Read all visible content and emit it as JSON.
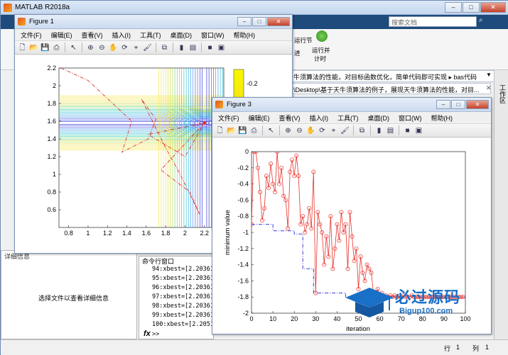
{
  "app": {
    "title": "MATLAB R2018a",
    "search_placeholder": "搜索文档",
    "ribbon_items": [
      "运行节",
      "进",
      "运行并",
      "计时"
    ],
    "path_top": "牛须算法的性能，对目标函数优化，简单代码即可实现 ▸ bas代码",
    "path_second": "\\Desktop\\基于天牛须算法的例子，展现天牛须算法的性能，对目...",
    "workspace_label": "工作区",
    "detail_header": "详细信息",
    "detail_message": "选择文件以查看详细信息",
    "cmd_header": "命令行窗口",
    "cmd_lines": [
      "94:xbest=[2.20361",
      "95:xbest=[2.20361",
      "96:xbest=[2.20361",
      "97:xbest=[2.20361",
      "98:xbest=[2.20361",
      "99:xbest=[2.20361",
      "100:xbest=[2.2051"
    ],
    "cmd_prompt": ">>",
    "status_row_label": "行",
    "status_row": "1",
    "status_col_label": "列",
    "status_col": "1"
  },
  "figure1": {
    "title": "Figure 1",
    "menu": [
      "文件(F)",
      "编辑(E)",
      "查看(V)",
      "插入(I)",
      "工具(T)",
      "桌面(D)",
      "窗口(W)",
      "帮助(H)"
    ]
  },
  "figure3": {
    "title": "Figure 3",
    "menu": [
      "文件(F)",
      "编辑(E)",
      "查看(V)",
      "插入(I)",
      "工具(T)",
      "桌面(D)",
      "窗口(W)",
      "帮助(H)"
    ]
  },
  "watermark": {
    "text_cn": "必过源码",
    "text_en": "Bigup100.com"
  },
  "colors": {
    "accent": "#1e4a7c",
    "series_red": "#e8322b",
    "series_blue": "#3a3ad8"
  },
  "chart_data": [
    {
      "type": "contour",
      "title": "",
      "xlabel": "",
      "ylabel": "",
      "xlim": [
        0.7,
        2.4
      ],
      "ylim": [
        0.4,
        2.2
      ],
      "xticks": [
        0.8,
        1,
        1.2,
        1.4,
        1.6,
        1.8,
        2,
        2.2
      ],
      "xtick_labels": [
        "0.8",
        "1",
        "1.2",
        "1.4",
        "1.6",
        "1.8",
        "2",
        "2.2"
      ],
      "yticks": [
        0.6,
        0.8,
        1,
        1.2,
        1.4,
        1.6,
        1.8,
        2,
        2.2
      ],
      "ytick_labels": [
        "0.6",
        "0.8",
        "1",
        "1.2",
        "1.4",
        "1.6",
        "1.8",
        "2",
        "2.2"
      ],
      "colorbar_tick": "-0.2",
      "optimum": [
        2.2,
        1.58
      ]
    },
    {
      "type": "line",
      "title": "",
      "xlabel": "iteration",
      "ylabel": "minimum value",
      "xlim": [
        0,
        100
      ],
      "ylim": [
        -2,
        0
      ],
      "xticks": [
        0,
        10,
        20,
        30,
        40,
        50,
        60,
        70,
        80,
        90,
        100
      ],
      "yticks": [
        0,
        -0.2,
        -0.4,
        -0.6,
        -0.8,
        -1,
        -1.2,
        -1.4,
        -1.6,
        -1.8,
        -2
      ],
      "ytick_labels": [
        "0",
        "-0.2",
        "-0.4",
        "-0.6",
        "-0.8",
        "-1",
        "-1.2",
        "-1.4",
        "-1.6",
        "-1.8",
        "-2"
      ],
      "series": [
        {
          "values": [
            -0.9,
            0,
            0,
            -0.2,
            -0.5,
            -0.85,
            -0.7,
            -0.3,
            -0.45,
            -0.15,
            -0.4,
            -0.5,
            0,
            -0.4,
            -0.2,
            -0.55,
            -0.6,
            -0.95,
            -0.25,
            -0.1,
            -0.3,
            -0.05,
            -0.3,
            -0.9,
            -0.8,
            -1.0,
            -0.9,
            -0.7,
            -0.95,
            -0.25,
            -1.75,
            -0.75,
            -0.9,
            -1.0,
            -1.4,
            -1.05,
            -1.3,
            -0.8,
            -1.45,
            -1.2,
            -0.9,
            -1.1,
            -0.75,
            -1.0,
            -0.9,
            -1.45,
            -0.75,
            -1.05,
            -1.35,
            -1.2,
            -1.7,
            -1.3,
            -1.5,
            -1.6,
            -1.4,
            -1.45,
            -1.5,
            -1.75,
            -1.8,
            -1.7,
            -1.8,
            -1.75,
            -1.8,
            -1.78,
            -1.8,
            -1.78,
            -1.8,
            -1.78,
            -1.8,
            -1.79,
            -1.8,
            -1.78,
            -1.8,
            -1.8,
            -1.8,
            -1.78,
            -1.8,
            -1.8,
            -1.8,
            -1.8,
            -1.8,
            -1.8,
            -1.8,
            -1.8,
            -1.8,
            -1.8,
            -1.8,
            -1.8,
            -1.8,
            -1.8,
            -1.8,
            -1.8,
            -1.8,
            -1.8,
            -1.8,
            -1.8,
            -1.8,
            -1.8,
            -1.8,
            -1.8
          ]
        },
        {
          "values_steps": [
            [
              0,
              -0.9
            ],
            [
              10,
              -0.9
            ],
            [
              10,
              -0.98
            ],
            [
              20,
              -0.98
            ],
            [
              20,
              -1.02
            ],
            [
              24,
              -1.02
            ],
            [
              24,
              -1.45
            ],
            [
              29,
              -1.45
            ],
            [
              29,
              -1.75
            ],
            [
              44,
              -1.75
            ],
            [
              44,
              -1.8
            ],
            [
              100,
              -1.8
            ]
          ]
        }
      ]
    }
  ]
}
